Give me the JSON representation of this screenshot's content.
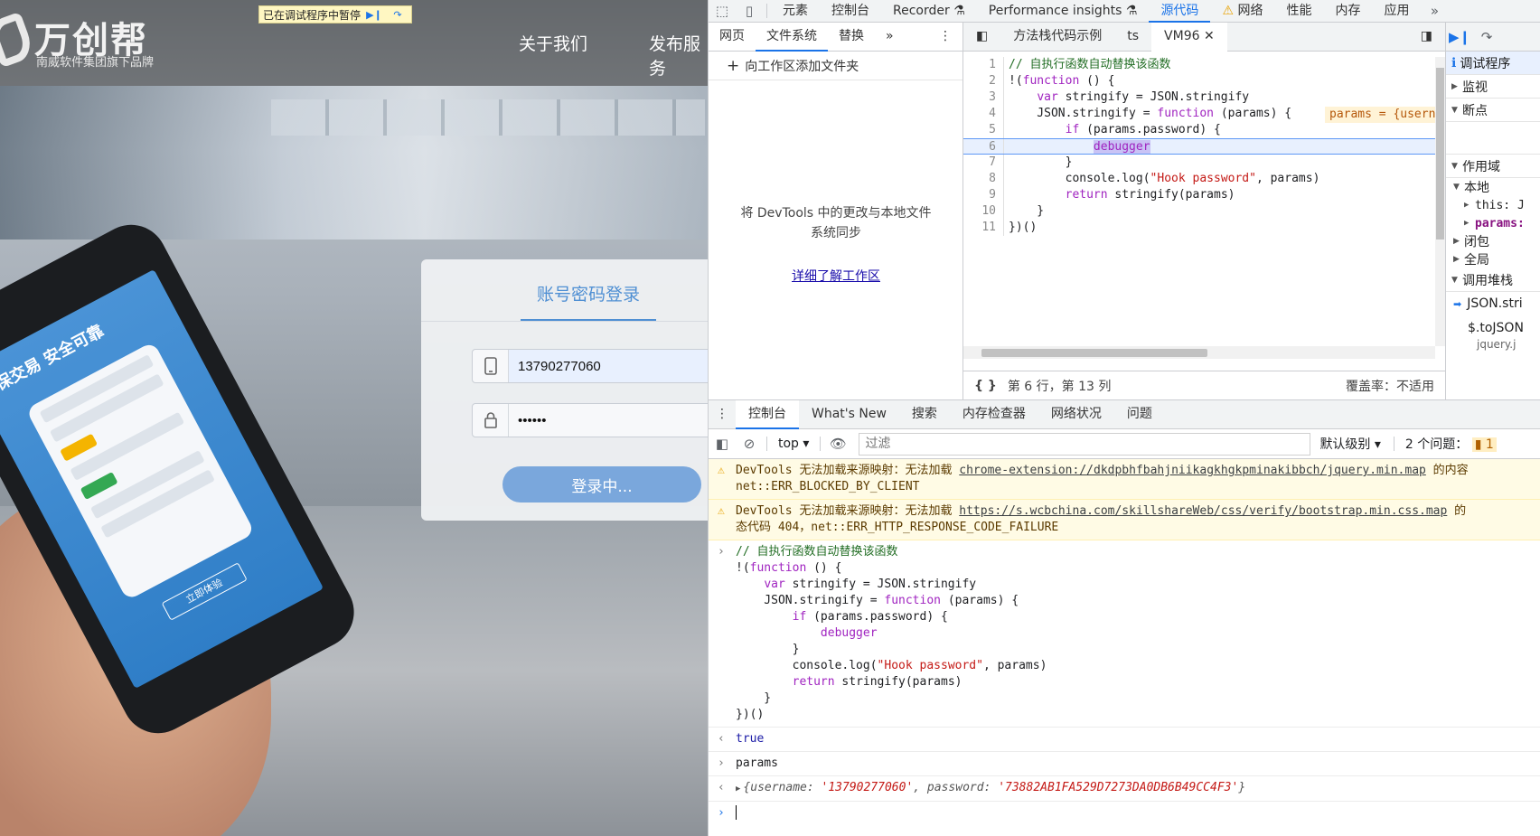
{
  "site": {
    "logo_title": "万创帮",
    "logo_sub": "南威软件集团旗下品牌",
    "nav": [
      "关于我们",
      "发布服务"
    ],
    "debug_banner": "已在调试程序中暂停",
    "phone_slogan": "保交易  安全可靠",
    "phone_cta": "立即体验",
    "login": {
      "tab": "账号密码登录",
      "phone_value": "13790277060",
      "password_value": "••••••",
      "button": "登录中..."
    }
  },
  "devtools": {
    "main_tabs": [
      "元素",
      "控制台",
      "Recorder",
      "Performance insights",
      "源代码",
      "网络",
      "性能",
      "内存",
      "应用"
    ],
    "active_tab": "源代码",
    "navigator": {
      "tabs": [
        "网页",
        "文件系统",
        "替换"
      ],
      "add_folder": "向工作区添加文件夹",
      "empty_text": "将 DevTools 中的更改与本地文件系统同步",
      "learn_link": "详细了解工作区"
    },
    "editor": {
      "tabs": [
        "方法栈代码示例",
        "ts",
        "VM96"
      ],
      "code_lines": [
        "// 自执行函数自动替换该函数",
        "!(function () {",
        "    var stringify = JSON.stringify",
        "    JSON.stringify = function (params) {",
        "        if (params.password) {",
        "            debugger",
        "        }",
        "        console.log(\"Hook password\", params)",
        "        return stringify(params)",
        "    }",
        "})()"
      ],
      "inline_value": "params = {userna",
      "status_position": "第 6 行，第 13 列",
      "coverage": "覆盖率：不适用"
    },
    "sidebar": {
      "paused": "调试程序",
      "watch": "监视",
      "breakpoints": "断点",
      "scope": "作用域",
      "local": "本地",
      "this": "this: J",
      "params": "params:",
      "closure": "闭包",
      "global": "全局",
      "callstack": "调用堆栈",
      "frame1": "JSON.stri",
      "frame2": "$.toJSON",
      "frame2_file": "jquery.j"
    },
    "drawer": {
      "tabs": [
        "控制台",
        "What's New",
        "搜索",
        "内存检查器",
        "网络状况",
        "问题"
      ],
      "context": "top",
      "filter_placeholder": "过滤",
      "level": "默认级别",
      "issues": "2 个问题：",
      "issues_count": "1"
    },
    "console": {
      "warn1_text": "DevTools 无法加载来源映射：无法加载 ",
      "warn1_link": "chrome-extension://dkdpbhfbahjniikagkhgkpminakibbch/jquery.min.map",
      "warn1_tail": " 的内容",
      "warn1_line2": "net::ERR_BLOCKED_BY_CLIENT",
      "warn2_text": "DevTools 无法加载来源映射：无法加载 ",
      "warn2_link": "https://s.wcbchina.com/skillshareWeb/css/verify/bootstrap.min.css.map",
      "warn2_tail": " 的",
      "warn2_line2": "态代码 404，net::ERR_HTTP_RESPONSE_CODE_FAILURE",
      "input_code": "// 自执行函数自动替换该函数\n!(function () {\n    var stringify = JSON.stringify\n    JSON.stringify = function (params) {\n        if (params.password) {\n            debugger\n        }\n        console.log(\"Hook password\", params)\n        return stringify(params)\n    }\n})()",
      "result1": "true",
      "input2": "params",
      "obj_open": "{",
      "k_username": "username: ",
      "v_username": "'13790277060'",
      "k_password": ", password: ",
      "v_password": "'73882AB1FA529D7273DA0DB6B49CC4F3'",
      "obj_close": "}"
    }
  }
}
